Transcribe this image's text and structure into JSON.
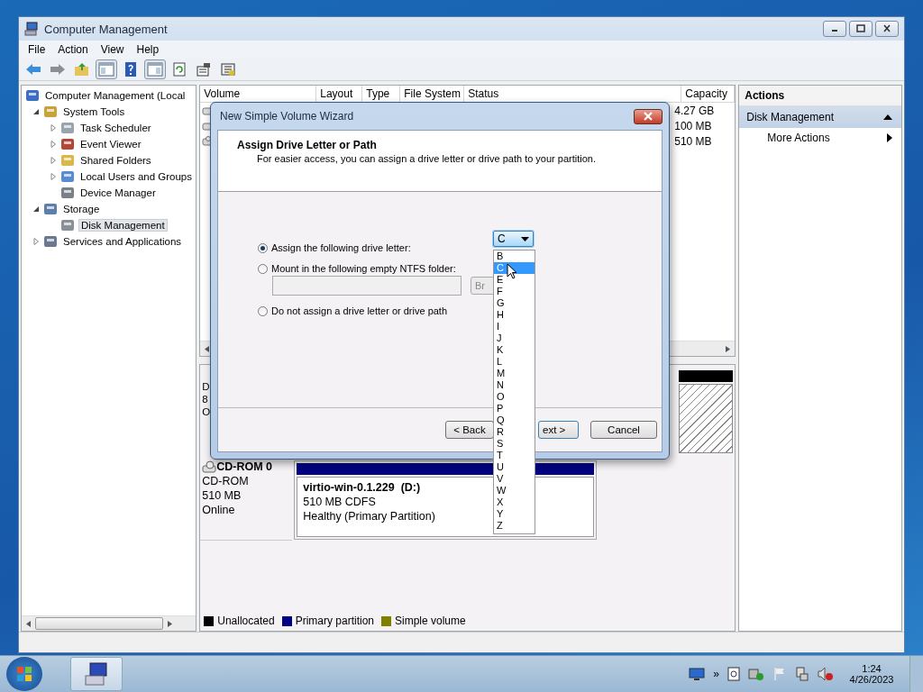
{
  "window": {
    "title": "Computer Management"
  },
  "menu": [
    {
      "label": "File"
    },
    {
      "label": "Action"
    },
    {
      "label": "View"
    },
    {
      "label": "Help"
    }
  ],
  "tree": [
    {
      "label": "Computer Management (Local",
      "kind": "root",
      "selected": false,
      "children": [
        {
          "label": "System Tools",
          "kind": "branch",
          "expanded": true,
          "selected": false,
          "children": [
            {
              "label": "Task Scheduler",
              "kind": "branch",
              "expanded": false,
              "selected": false
            },
            {
              "label": "Event Viewer",
              "kind": "branch",
              "expanded": false,
              "selected": false
            },
            {
              "label": "Shared Folders",
              "kind": "branch",
              "expanded": false,
              "selected": false
            },
            {
              "label": "Local Users and Groups",
              "kind": "branch",
              "expanded": false,
              "selected": false
            },
            {
              "label": "Device Manager",
              "kind": "leaf",
              "selected": false
            }
          ]
        },
        {
          "label": "Storage",
          "kind": "branch",
          "expanded": true,
          "selected": false,
          "children": [
            {
              "label": "Disk Management",
              "kind": "leaf",
              "selected": true
            }
          ]
        },
        {
          "label": "Services and Applications",
          "kind": "branch",
          "expanded": false,
          "selected": false
        }
      ]
    }
  ],
  "volume_list": {
    "columns": [
      "Volume",
      "Layout",
      "Type",
      "File System",
      "Status",
      "Capacity"
    ],
    "rows": [
      {
        "kind": "drive",
        "capacity": "4.27 GB"
      },
      {
        "kind": "drive",
        "capacity": "100 MB"
      },
      {
        "kind": "cdrom",
        "capacity": "510 MB"
      }
    ]
  },
  "disks": [
    {
      "kind": "partial",
      "label_lines": [
        "D",
        "8",
        "O"
      ]
    },
    {
      "kind": "cdrom",
      "name": "CD-ROM 0",
      "label_lines": [
        "CD-ROM",
        "510 MB",
        "Online"
      ],
      "partition": {
        "title": "virtio-win-0.1.229  (D:)",
        "lines": [
          "510 MB CDFS",
          "Healthy (Primary Partition)"
        ],
        "color": "#000080"
      }
    }
  ],
  "legend": [
    {
      "label": "Unallocated",
      "color": "#000000"
    },
    {
      "label": "Primary partition",
      "color": "#000080"
    },
    {
      "label": "Simple volume",
      "color": "#808000"
    }
  ],
  "actions": {
    "title": "Actions",
    "section": "Disk Management",
    "items": [
      {
        "label": "More Actions"
      }
    ]
  },
  "dialog": {
    "title": "New Simple Volume Wizard",
    "heading": "Assign Drive Letter or Path",
    "subheading": "For easier access, you can assign a drive letter or drive path to your partition.",
    "options": [
      {
        "label": "Assign the following drive letter:",
        "selected": true
      },
      {
        "label": "Mount in the following empty NTFS folder:",
        "selected": false
      },
      {
        "label": "Do not assign a drive letter or drive path",
        "selected": false
      }
    ],
    "browse_button": "Br",
    "drive_letter": {
      "value": "C",
      "expanded": true,
      "options": [
        {
          "label": "B",
          "selected": false
        },
        {
          "label": "C",
          "selected": true
        },
        {
          "label": "E",
          "selected": false
        },
        {
          "label": "F",
          "selected": false
        },
        {
          "label": "G",
          "selected": false
        },
        {
          "label": "H",
          "selected": false
        },
        {
          "label": "I",
          "selected": false
        },
        {
          "label": "J",
          "selected": false
        },
        {
          "label": "K",
          "selected": false
        },
        {
          "label": "L",
          "selected": false
        },
        {
          "label": "M",
          "selected": false
        },
        {
          "label": "N",
          "selected": false
        },
        {
          "label": "O",
          "selected": false
        },
        {
          "label": "P",
          "selected": false
        },
        {
          "label": "Q",
          "selected": false
        },
        {
          "label": "R",
          "selected": false
        },
        {
          "label": "S",
          "selected": false
        },
        {
          "label": "T",
          "selected": false
        },
        {
          "label": "U",
          "selected": false
        },
        {
          "label": "V",
          "selected": false
        },
        {
          "label": "W",
          "selected": false
        },
        {
          "label": "X",
          "selected": false
        },
        {
          "label": "Y",
          "selected": false
        },
        {
          "label": "Z",
          "selected": false
        }
      ]
    },
    "buttons": [
      "< Back",
      "ext >",
      "Cancel"
    ]
  },
  "taskbar": {
    "overflow": "»",
    "time": "1:24",
    "date": "4/26/2023"
  }
}
